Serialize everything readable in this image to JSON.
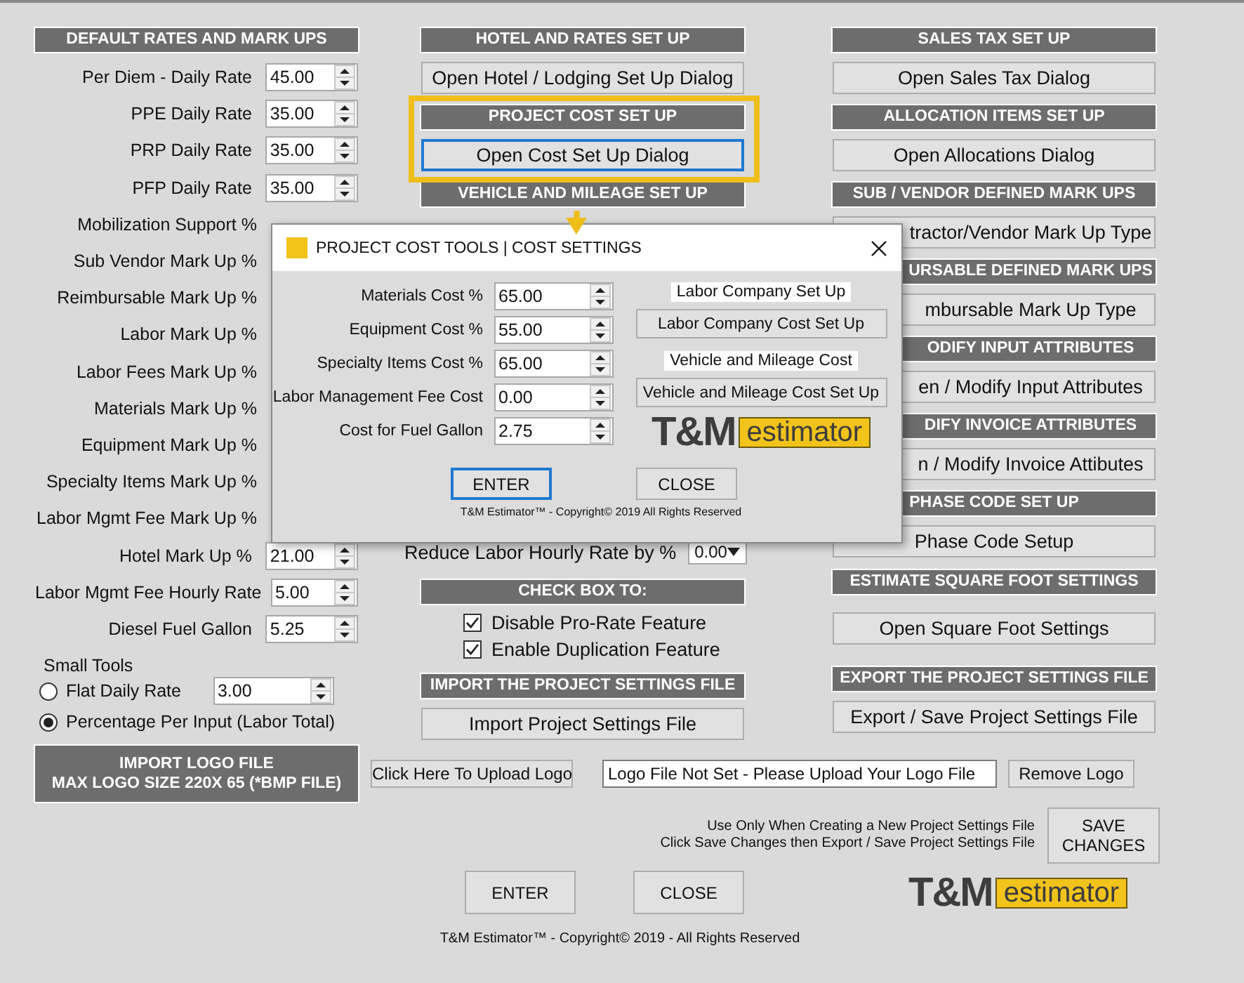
{
  "default_rates": {
    "title": "DEFAULT RATES AND MARK UPS",
    "rows": [
      {
        "label": "Per Diem - Daily Rate",
        "value": "45.00"
      },
      {
        "label": "PPE Daily Rate",
        "value": "35.00"
      },
      {
        "label": "PRP Daily Rate",
        "value": "35.00"
      },
      {
        "label": "PFP Daily Rate",
        "value": "35.00"
      },
      {
        "label": "Mobilization Support %"
      },
      {
        "label": "Sub Vendor Mark Up %"
      },
      {
        "label": "Reimbursable Mark Up %"
      },
      {
        "label": "Labor Mark Up  %"
      },
      {
        "label": "Labor Fees Mark Up  %"
      },
      {
        "label": "Materials Mark Up  %"
      },
      {
        "label": "Equipment Mark Up  %"
      },
      {
        "label": "Specialty Items Mark Up  %"
      },
      {
        "label": "Labor Mgmt Fee Mark Up  %"
      },
      {
        "label": "Hotel Mark Up  %",
        "value": "21.00"
      },
      {
        "label": "Labor Mgmt Fee Hourly Rate",
        "value": "5.00"
      },
      {
        "label": "Diesel Fuel Gallon",
        "value": "5.25"
      }
    ],
    "small_tools": {
      "label": "Small Tools",
      "options": [
        {
          "label": "Flat Daily Rate",
          "selected": false,
          "value": "3.00"
        },
        {
          "label": "Percentage Per Input (Labor Total)",
          "selected": true
        }
      ]
    }
  },
  "middle_column": [
    {
      "kind": "header",
      "text": "HOTEL AND RATES SET UP"
    },
    {
      "kind": "button",
      "text": "Open Hotel / Lodging Set Up Dialog",
      "focused": false
    },
    {
      "kind": "header",
      "text": "PROJECT COST SET UP"
    },
    {
      "kind": "button",
      "text": "Open Cost Set Up Dialog",
      "focused": true
    },
    {
      "kind": "header",
      "text": "VEHICLE AND MILEAGE SET UP"
    },
    {
      "kind": "field",
      "text": "Reduce Labor Hourly Rate by %",
      "value": "0.00"
    },
    {
      "kind": "header",
      "text": "CHECK BOX TO:"
    },
    {
      "kind": "checkbox",
      "text": "Disable Pro-Rate Feature",
      "checked": true
    },
    {
      "kind": "checkbox",
      "text": "Enable Duplication Feature",
      "checked": true
    },
    {
      "kind": "header",
      "text": "IMPORT THE PROJECT SETTINGS FILE"
    },
    {
      "kind": "button",
      "text": "Import Project Settings File",
      "focused": false
    }
  ],
  "right_column": [
    {
      "kind": "header",
      "text": "SALES TAX SET UP",
      "covered": false
    },
    {
      "kind": "button",
      "text": "Open Sales Tax Dialog",
      "covered": false
    },
    {
      "kind": "header",
      "text": "ALLOCATION ITEMS SET UP",
      "covered": false
    },
    {
      "kind": "button",
      "text": "Open Allocations Dialog",
      "covered": false
    },
    {
      "kind": "header",
      "text": "SUB / VENDOR DEFINED MARK UPS",
      "covered": false
    },
    {
      "kind": "button",
      "text": "tractor/Vendor Mark Up Type",
      "covered": true
    },
    {
      "kind": "header",
      "text": "URSABLE DEFINED MARK UPS",
      "covered": true
    },
    {
      "kind": "button",
      "text": "mbursable Mark Up Type",
      "covered": true
    },
    {
      "kind": "header",
      "text": "ODIFY INPUT ATTRIBUTES",
      "covered": true
    },
    {
      "kind": "button",
      "text": "en / Modify Input Attributes",
      "covered": true
    },
    {
      "kind": "header",
      "text": "DIFY INVOICE ATTRIBUTES",
      "covered": true
    },
    {
      "kind": "button",
      "text": "n / Modify  Invoice Attibutes",
      "covered": true
    },
    {
      "kind": "header",
      "text": "PHASE CODE SET UP",
      "covered": false
    },
    {
      "kind": "button",
      "text": "Phase Code Setup",
      "covered": false
    },
    {
      "kind": "header",
      "text": "ESTIMATE SQUARE FOOT SETTINGS",
      "covered": false
    },
    {
      "kind": "button",
      "text": "Open Square Foot Settings",
      "covered": false
    },
    {
      "kind": "header",
      "text": "EXPORT THE PROJECT SETTINGS FILE",
      "covered": false
    },
    {
      "kind": "button",
      "text": "Export / Save Project  Settings File",
      "covered": false
    }
  ],
  "logo_import": {
    "title": "IMPORT LOGO FILE",
    "subtitle": "MAX LOGO SIZE 220X 65 (*BMP FILE)",
    "upload_button": "Click Here To Upload Logo",
    "file_field": "Logo File Not Set - Please Upload Your Logo File",
    "remove_button": "Remove Logo"
  },
  "save": {
    "notes": [
      "Use Only When Creating a New Project Settings File",
      "Click Save Changes then Export / Save Project Settings File"
    ],
    "button": "SAVE\nCHANGES"
  },
  "buttons": [
    "ENTER",
    "CLOSE"
  ],
  "logo": {
    "mark": "T&M",
    "word": "estimator"
  },
  "copyright": "T&M Estimator™ - Copyright© 2019 - All Rights Reserved",
  "dialog": {
    "title": "PROJECT COST TOOLS | COST SETTINGS",
    "fields": [
      {
        "label": "Materials Cost %",
        "value": "65.00"
      },
      {
        "label": "Equipment Cost %",
        "value": "55.00"
      },
      {
        "label": "Specialty Items Cost %",
        "value": "65.00"
      },
      {
        "label": "Labor Management Fee Cost",
        "value": "0.00"
      },
      {
        "label": "Cost for Fuel Gallon",
        "value": "2.75"
      }
    ],
    "actions": [
      {
        "caption": "Labor Company Set Up",
        "button": "Labor Company Cost Set Up"
      },
      {
        "caption": "Vehicle and Mileage Cost",
        "button": "Vehicle and Mileage Cost Set Up"
      }
    ],
    "logo": {
      "mark": "T&M",
      "word": "estimator"
    },
    "buttons": [
      {
        "text": "ENTER",
        "focused": true
      },
      {
        "text": "CLOSE",
        "focused": false
      }
    ],
    "copyright": "T&M Estimator™ - Copyright© 2019  All Rights Reserved"
  }
}
